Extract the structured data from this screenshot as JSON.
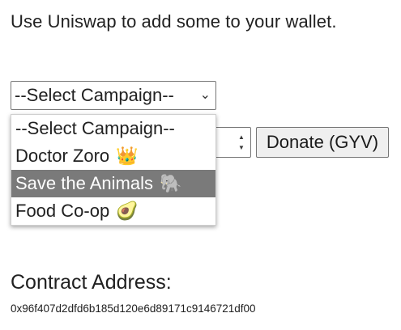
{
  "intro_text": "Use Uniswap to add some to your wallet.",
  "campaign_select": {
    "selected": "--Select Campaign--",
    "arrow_icon": "chevron-down-icon",
    "options": [
      {
        "label": "--Select Campaign--",
        "emoji": ""
      },
      {
        "label": "Doctor Zoro",
        "emoji": "👑"
      },
      {
        "label": "Save the Animals",
        "emoji": "🐘"
      },
      {
        "label": "Food Co-op",
        "emoji": "🥑"
      }
    ],
    "highlighted_option": "Save the Animals"
  },
  "amount_input": {
    "value": "",
    "spinner_up_icon": "triangle-up-icon",
    "spinner_down_icon": "triangle-down-icon"
  },
  "donate_button": {
    "label": "Donate (GYV)"
  },
  "contract": {
    "label": "Contract Address:",
    "address": "0x96f407d2dfd6b185d120e6d89171c9146721df00"
  },
  "colors": {
    "highlight_bg": "#7a7a7a",
    "button_bg": "#efefef",
    "border": "#767676"
  }
}
